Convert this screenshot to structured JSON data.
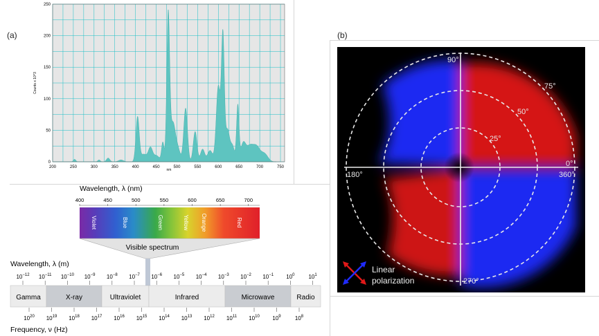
{
  "labels": {
    "a": "(a)",
    "b": "(b)"
  },
  "spectrum": {
    "ylabel": "Counts x 10^3",
    "xlabel": "nm",
    "xticks": [
      "200",
      "250",
      "300",
      "350",
      "400",
      "450",
      "500",
      "550",
      "600",
      "650",
      "700",
      "750"
    ],
    "yticks": [
      "0",
      "50",
      "100",
      "150",
      "200",
      "250"
    ],
    "fill": "#5ec4c0",
    "grid": "#17bfc6"
  },
  "em": {
    "wavelength_nm_title": "Wavelength, λ (nm)",
    "nm_ticks": [
      "400",
      "450",
      "500",
      "550",
      "600",
      "650",
      "700"
    ],
    "colors": [
      {
        "name": "Violet"
      },
      {
        "name": "Blue"
      },
      {
        "name": "Green"
      },
      {
        "name": "Yellow"
      },
      {
        "name": "Orange"
      },
      {
        "name": "Red"
      }
    ],
    "visible_label": "Visible spectrum",
    "wavelength_m_title": "Wavelength, λ (m)",
    "wl_exponents": [
      "−12",
      "−11",
      "−10",
      "−9",
      "−8",
      "−7",
      "−6",
      "−5",
      "−4",
      "−3",
      "−2",
      "−1",
      "0",
      "1"
    ],
    "bands": [
      {
        "name": "Gamma"
      },
      {
        "name": "X-ray"
      },
      {
        "name": "Ultraviolet"
      },
      {
        "name": "Infrared"
      },
      {
        "name": "Microwave"
      },
      {
        "name": "Radio"
      }
    ],
    "freq_exponents": [
      "20",
      "19",
      "18",
      "17",
      "16",
      "15",
      "14",
      "13",
      "12",
      "11",
      "10",
      "9",
      "8"
    ],
    "frequency_title": "Frequency, ν (Hz)"
  },
  "polar": {
    "angle_labels": {
      "a90": "90°",
      "a0": "0°",
      "a180": "180°",
      "a360": "360°",
      "a270": "270°"
    },
    "ring_labels": {
      "r25": "25°",
      "r50": "50°",
      "r75": "75°"
    },
    "legend_line1": "Linear",
    "legend_line2": "polarization",
    "colors": {
      "blue": "#1f2bff",
      "red": "#e01818"
    }
  }
}
